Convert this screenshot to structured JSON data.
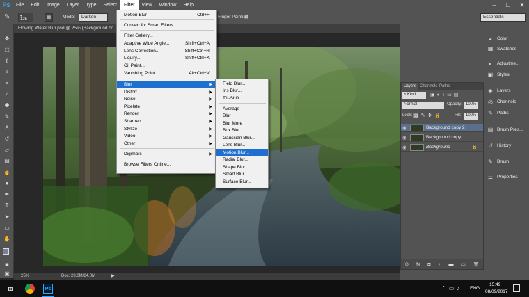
{
  "app": {
    "logo": "Ps"
  },
  "menubar": {
    "items": [
      "File",
      "Edit",
      "Image",
      "Layer",
      "Type",
      "Select",
      "Filter",
      "View",
      "Window",
      "Help"
    ],
    "active": "Filter"
  },
  "options_bar": {
    "brush_size": "125",
    "mode_label": "Mode:",
    "mode_value": "Darken",
    "partial_label": "Finger Painting",
    "workspace": "Essentials"
  },
  "document": {
    "tab_title": "Flowing Water Blur.psd @ 25% (Background co..."
  },
  "status": {
    "zoom": "25%",
    "doc_info": "Doc: 28.0M/84.0M"
  },
  "filter_menu": {
    "last_filter": "Motion Blur",
    "last_filter_shortcut": "Ctrl+F",
    "convert_smart": "Convert for Smart Filters",
    "gallery": "Filter Gallery...",
    "adaptive": "Adaptive Wide Angle...",
    "adaptive_shortcut": "Shift+Ctrl+A",
    "lens_correction": "Lens Correction...",
    "lens_shortcut": "Shift+Ctrl+R",
    "liquify": "Liquify...",
    "liquify_shortcut": "Shift+Ctrl+X",
    "oil_paint": "Oil Paint...",
    "vanishing": "Vanishing Point...",
    "vanishing_shortcut": "Alt+Ctrl+V",
    "submenus": [
      "Blur",
      "Distort",
      "Noise",
      "Pixelate",
      "Render",
      "Sharpen",
      "Stylize",
      "Video",
      "Other"
    ],
    "digimarc": "Digimarc",
    "browse": "Browse Filters Online..."
  },
  "blur_menu": {
    "items_top": [
      "Field Blur...",
      "Iris Blur...",
      "Tilt-Shift..."
    ],
    "items_bottom": [
      "Average",
      "Blur",
      "Blur More",
      "Box Blur...",
      "Gaussian Blur...",
      "Lens Blur...",
      "Motion Blur...",
      "Radial Blur...",
      "Shape Blur...",
      "Smart Blur...",
      "Surface Blur..."
    ],
    "highlighted": "Motion Blur..."
  },
  "right_strip": {
    "items": [
      "Color",
      "Swatches",
      "Adjustme...",
      "Styles",
      "Layers",
      "Channels",
      "Paths",
      "Brush Pres...",
      "History",
      "Brush",
      "Properties"
    ]
  },
  "layers_panel": {
    "tabs": [
      "Layers",
      "Channels",
      "Paths"
    ],
    "kind_label": "Kind",
    "blend_mode": "Normal",
    "opacity_label": "Opacity:",
    "opacity_value": "100%",
    "lock_label": "Lock:",
    "fill_label": "Fill:",
    "fill_value": "100%",
    "layers": [
      "Background copy 2",
      "Background copy",
      "Background"
    ]
  },
  "taskbar": {
    "lang": "ENG",
    "time": "15:49",
    "date": "08/09/2017"
  },
  "colors": {
    "highlight": "#1f6fd0",
    "ui_bg": "#535353",
    "ps_blue": "#31a8ff"
  }
}
